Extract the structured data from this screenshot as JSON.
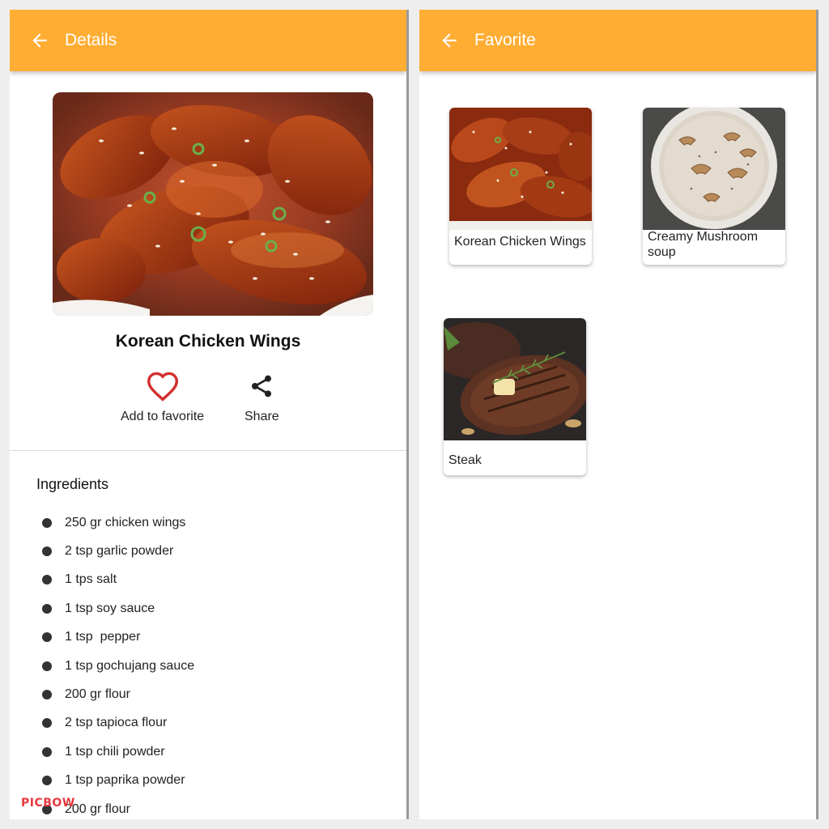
{
  "details": {
    "appbar_title": "Details",
    "dish_title": "Korean Chicken Wings",
    "favorite_label": "Add to favorite",
    "share_label": "Share",
    "ingredients_title": "Ingredients",
    "ingredients": [
      "250 gr chicken wings",
      "2 tsp garlic powder",
      "1 tps salt",
      "1 tsp soy sauce",
      "1 tsp  pepper",
      "1 tsp gochujang sauce",
      "200 gr flour",
      "2 tsp tapioca flour",
      "1 tsp chili powder",
      "1 tsp paprika powder",
      "200 gr flour"
    ]
  },
  "favorite": {
    "appbar_title": "Favorite",
    "items": [
      {
        "name": "Korean Chicken Wings"
      },
      {
        "name": "Creamy Mushroom soup"
      },
      {
        "name": "Steak"
      }
    ]
  },
  "watermark": "PICBOW",
  "colors": {
    "appbar": "#FFAD33",
    "heart": "#D32F2F",
    "background": "#FFFFFF"
  },
  "icons": {
    "back": "arrow-left-icon",
    "favorite": "heart-outline-icon",
    "share": "share-icon",
    "bullet": "bullet-dot-icon"
  }
}
